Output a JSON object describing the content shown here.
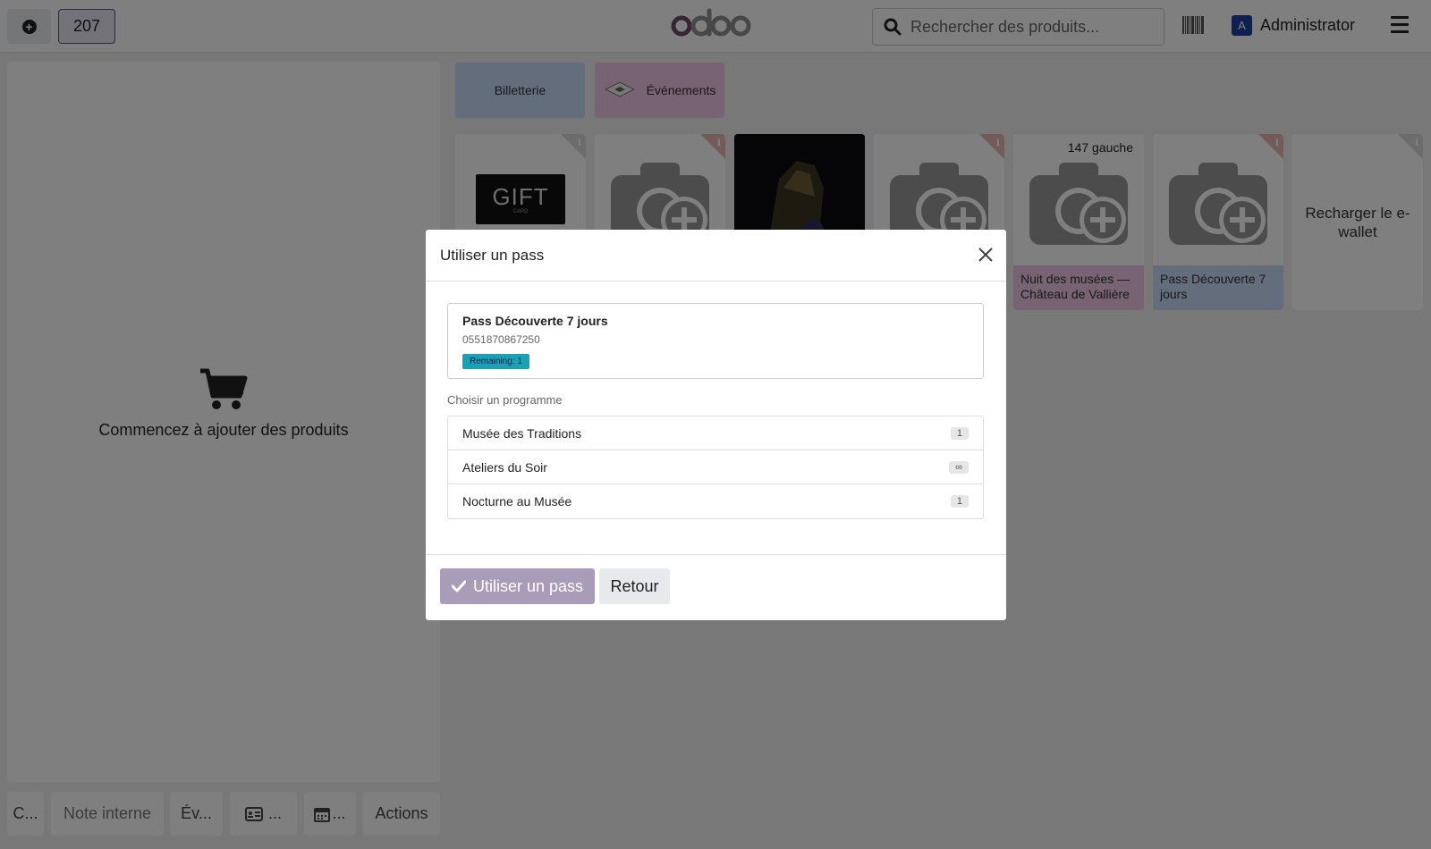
{
  "topbar": {
    "order_number": "207",
    "logo_text": "odoo",
    "search_placeholder": "Rechercher des produits...",
    "user_initial": "A",
    "user_name": "Administrator"
  },
  "cart": {
    "empty_text": "Commencez à ajouter des produits"
  },
  "bottom_buttons": {
    "customer": "C...",
    "internal_note": "Note interne",
    "event": "Év...",
    "card_ellipsis": "...",
    "calendar_ellipsis": "...",
    "actions": "Actions"
  },
  "categories": [
    {
      "label": "Billetterie",
      "color": "#c9daf8"
    },
    {
      "label": "Événements",
      "color": "#f0c6e4"
    }
  ],
  "products": [
    {
      "name": "Gift card",
      "image_text": "GIFT",
      "image_subtext": "CARD"
    },
    {
      "name": "",
      "image": "camera-placeholder"
    },
    {
      "name": "",
      "image": "photo-night"
    },
    {
      "name": "",
      "image": "camera-placeholder"
    },
    {
      "name": "Nuit des musées — Château de Vallière",
      "badge": "147 gauche",
      "color": "#f0c6e4"
    },
    {
      "name": "Pass Découverte 7 jours",
      "color": "#c9daf8"
    },
    {
      "name": "Recharger le e-wallet"
    }
  ],
  "modal": {
    "title": "Utiliser un pass",
    "pass": {
      "name": "Pass Découverte 7 jours",
      "code": "0551870867250",
      "remaining": "Remaining: 1"
    },
    "choose_label": "Choisir un programme",
    "programs": [
      {
        "name": "Musée des Traditions",
        "count": "1"
      },
      {
        "name": "Ateliers du Soir",
        "count": "∞"
      },
      {
        "name": "Nocturne au Musée",
        "count": "1"
      }
    ],
    "confirm_label": "Utiliser un pass",
    "back_label": "Retour"
  },
  "colors": {
    "primary": "#714b67",
    "overlay": "rgba(0,0,0,0.5)",
    "badge_teal": "#17a2b8"
  }
}
